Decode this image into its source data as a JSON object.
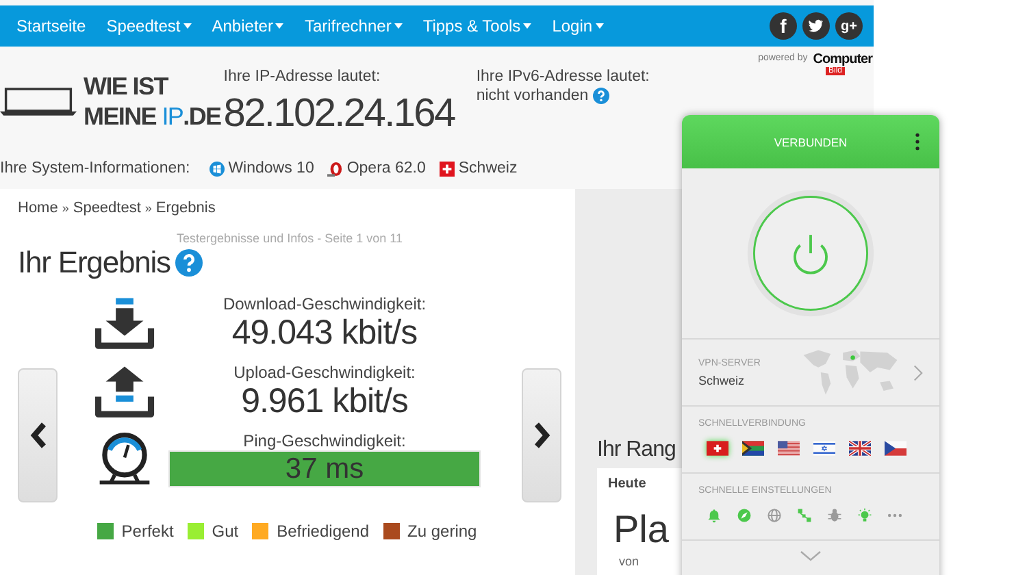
{
  "nav": {
    "items": [
      {
        "label": "Startseite",
        "dropdown": false
      },
      {
        "label": "Speedtest",
        "dropdown": true
      },
      {
        "label": "Anbieter",
        "dropdown": true
      },
      {
        "label": "Tarifrechner",
        "dropdown": true
      },
      {
        "label": "Tipps & Tools",
        "dropdown": true
      },
      {
        "label": "Login",
        "dropdown": true
      }
    ],
    "social": [
      {
        "kind": "facebook",
        "label": "f"
      },
      {
        "kind": "twitter"
      },
      {
        "kind": "googleplus",
        "label": "g+"
      }
    ]
  },
  "powered_by": {
    "label": "powered by",
    "brand": "Computer",
    "brand_sub": "Bild"
  },
  "logo": {
    "line1": "WIE IST",
    "line2": "MEINE ",
    "highlight": "IP",
    "suffix": ".DE"
  },
  "ip": {
    "label": "Ihre IP-Adresse lautet:",
    "value": "82.102.24.164"
  },
  "ipv6": {
    "label": "Ihre IPv6-Adresse lautet:",
    "value": "nicht vorhanden"
  },
  "system_info": {
    "label": "Ihre System-Informationen:",
    "items": [
      {
        "kind": "windows",
        "label": "Windows 10"
      },
      {
        "kind": "opera",
        "label": "Opera 62.0"
      },
      {
        "kind": "swiss-flag",
        "label": "Schweiz"
      }
    ]
  },
  "result": {
    "breadcrumb": [
      "Home",
      "Speedtest",
      "Ergebnis"
    ],
    "separator": "»",
    "subtitle": "Testergebnisse und Infos - Seite 1 von 11",
    "title": "Ihr Ergebnis",
    "metrics": [
      {
        "kind": "download",
        "label": "Download-Geschwindigkeit:",
        "value": "49.043 kbit/s"
      },
      {
        "kind": "upload",
        "label": "Upload-Geschwindigkeit:",
        "value": "9.961 kbit/s"
      },
      {
        "kind": "ping",
        "label": "Ping-Geschwindigkeit:",
        "value": "37 ms",
        "color": "#46a844"
      }
    ],
    "legend": [
      {
        "label": "Perfekt",
        "color": "#46a844"
      },
      {
        "label": "Gut",
        "color": "#99ee33"
      },
      {
        "label": "Befriedigend",
        "color": "#ffaa22"
      },
      {
        "label": "Zu gering",
        "color": "#aa4a1e"
      }
    ]
  },
  "rank": {
    "title": "Ihr Rang",
    "tabs": [
      {
        "label": "Heute",
        "selected": true
      }
    ],
    "place": "Pla",
    "of": "von"
  },
  "vpn": {
    "status": "VERBUNDEN",
    "connected": true,
    "server_label": "VPN-SERVER",
    "server": "Schweiz",
    "quick_label": "SCHNELLVERBINDUNG",
    "flags": [
      {
        "kind": "ch",
        "selected": true
      },
      {
        "kind": "za",
        "selected": false
      },
      {
        "kind": "us",
        "selected": false
      },
      {
        "kind": "il",
        "selected": false
      },
      {
        "kind": "gb",
        "selected": false
      },
      {
        "kind": "cz",
        "selected": false
      }
    ],
    "settings_label": "SCHNELLE EINSTELLUNGEN",
    "settings": [
      {
        "kind": "bell",
        "on": true
      },
      {
        "kind": "compass",
        "on": true
      },
      {
        "kind": "globe",
        "on": false
      },
      {
        "kind": "network",
        "on": true
      },
      {
        "kind": "bug",
        "on": false
      },
      {
        "kind": "bulb",
        "on": true
      },
      {
        "kind": "more",
        "on": false
      }
    ]
  }
}
